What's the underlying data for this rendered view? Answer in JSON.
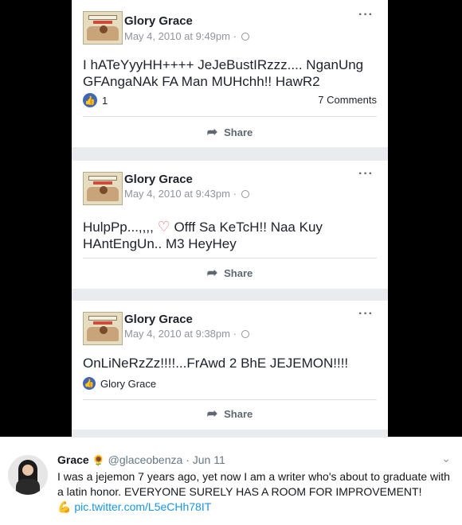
{
  "posts": [
    {
      "author": "Glory Grace",
      "meta": "May 4, 2010 at 9:49pm ·",
      "text": "I hATeYyyHH++++ JeJeBustIRzzz.... NganUng GFAngaNAk FA Man MUHchh!! HawR2",
      "likes": "1",
      "comments": "7 Comments",
      "share": "Share"
    },
    {
      "author": "Glory Grace",
      "meta": "May 4, 2010 at 9:43pm ·",
      "text_a": "HulpPp...,,,,",
      "text_b": "Offf Sa KeTcH!! Naa Kuy HAntEngUn.. M3 HeyHey",
      "share": "Share"
    },
    {
      "author": "Glory Grace",
      "meta": "May 4, 2010 at 9:38pm ·",
      "text": "OnLiNeRzZz!!!!...FrAwd 2 BhE JEJEMON!!!!",
      "liker": "Glory Grace",
      "share": "Share"
    }
  ],
  "tweet": {
    "name": "Grace",
    "emoji": "🌻",
    "handle": "@glaceobenza",
    "date": "· Jun 11",
    "body": "I was a jejemon 7 years ago, yet now I am a writer who's about to graduate with a latin honor. EVERYONE SURELY HAS A ROOM FOR IMPROVEMENT!",
    "link": "pic.twitter.com/L5eCHh78IT",
    "link_emoji": "💪"
  },
  "icons": {
    "more": "more-dots-icon",
    "globe": "globe-icon",
    "like": "like-thumb-icon",
    "share": "share-arrow-icon",
    "caret": "chevron-down-icon"
  },
  "colors": {
    "facebook_blue": "#4267b2",
    "twitter_link": "#1b95e0"
  }
}
